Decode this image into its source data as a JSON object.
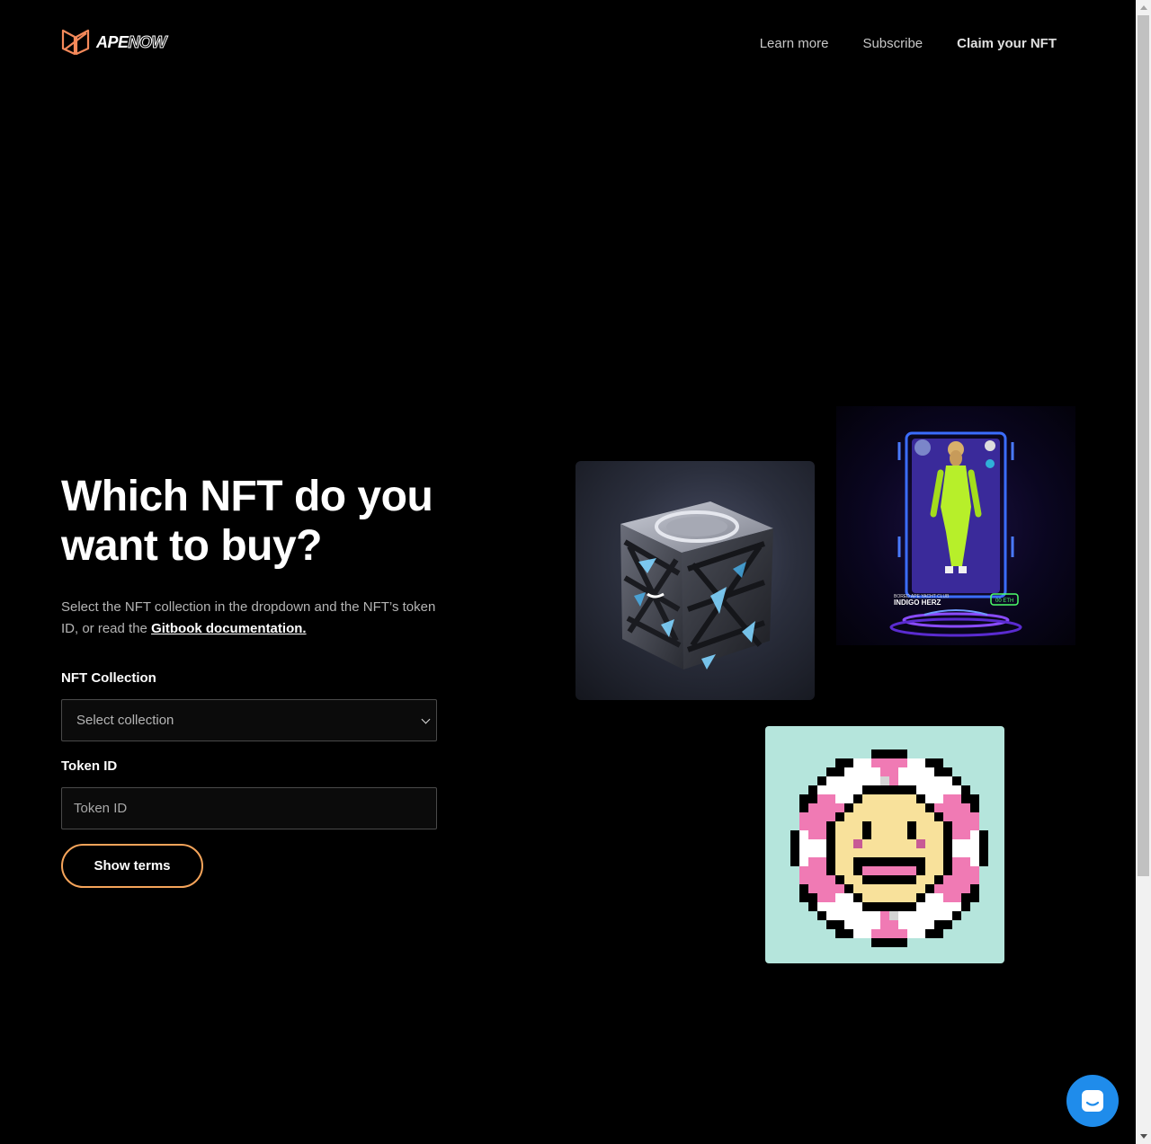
{
  "header": {
    "logo": {
      "brand_part1": "APE",
      "brand_part2": "NOW",
      "accent_color": "#f5895a"
    },
    "nav": [
      {
        "label": "Learn more"
      },
      {
        "label": "Subscribe"
      },
      {
        "label": "Claim your NFT"
      }
    ]
  },
  "hero": {
    "title": "Which NFT do you want to buy?",
    "description_prefix": "Select the NFT collection in the dropdown and the NFT’s token ID, or read the ",
    "description_link": "Gitbook documentation.",
    "form": {
      "collection_label": "NFT Collection",
      "collection_placeholder": "Select collection",
      "token_label": "Token ID",
      "token_placeholder": "Token ID",
      "submit_label": "Show terms"
    }
  },
  "gallery": {
    "ape_card": {
      "name": "INDIGO HERZ",
      "club": "BORED APE YACHT CLUB",
      "price": "00 ETH"
    }
  },
  "colors": {
    "button_border": "#f5a45a",
    "chat_bubble": "#1f8ceb",
    "flower_bg": "#b5e5dc"
  },
  "chat": {
    "icon": "chat-bubble-icon"
  }
}
